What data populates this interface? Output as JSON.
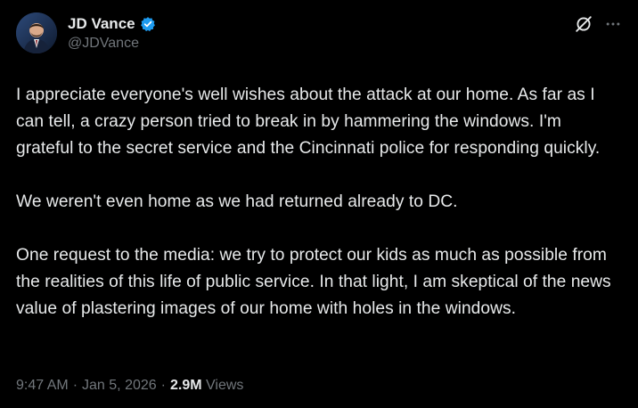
{
  "author": {
    "display_name": "JD Vance",
    "handle": "@JDVance",
    "verified": true,
    "avatar_icon": "profile-photo"
  },
  "tweet": {
    "paragraphs": [
      "I appreciate everyone's well wishes about the attack at our home. As far as I can tell, a crazy person tried to break in by hammering the windows. I'm grateful to the secret service and the Cincinnati police for responding quickly.",
      "We weren't even home as we had returned already to DC.",
      "One request to the media: we try to protect our kids as much as possible from the realities of this life of public service. In that light, I am skeptical of the news value of plastering images of our home with holes in the windows."
    ]
  },
  "meta": {
    "time": "9:47 AM",
    "separator": "·",
    "date": "Jan 5, 2026",
    "views_count": "2.9M",
    "views_label": "Views"
  },
  "icons": {
    "grok": "grok-icon",
    "more": "more-icon"
  },
  "colors": {
    "background": "#000000",
    "text": "#e7e9ea",
    "muted": "#71767b",
    "verified": "#1d9bf0"
  }
}
